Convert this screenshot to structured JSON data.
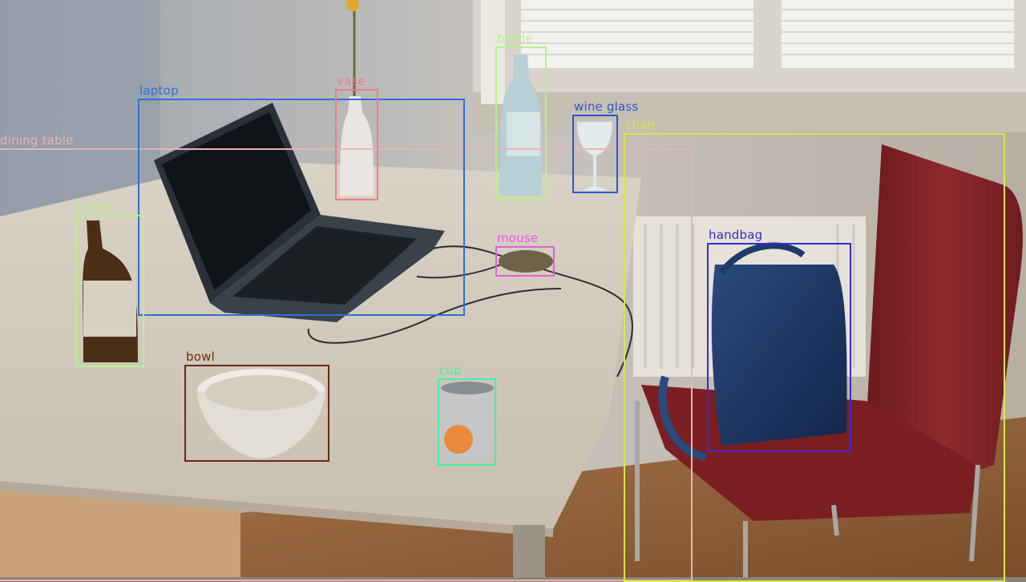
{
  "detections": [
    {
      "key": "dining_table",
      "label": "dining table",
      "color": "#e8b4b8"
    },
    {
      "key": "laptop",
      "label": "laptop",
      "color": "#2f6fd6"
    },
    {
      "key": "vase",
      "label": "vase",
      "color": "#f07a8a"
    },
    {
      "key": "bottle_1",
      "label": "bottle",
      "color": "#b8f08a"
    },
    {
      "key": "wine_glass",
      "label": "wine glass",
      "color": "#2a58c8"
    },
    {
      "key": "chair",
      "label": "chair",
      "color": "#d6e84a"
    },
    {
      "key": "mouse",
      "label": "mouse",
      "color": "#e060d8"
    },
    {
      "key": "handbag",
      "label": "handbag",
      "color": "#3a2ad0"
    },
    {
      "key": "bottle_2",
      "label": "bottle",
      "color": "#b8f08a"
    },
    {
      "key": "bowl",
      "label": "bowl",
      "color": "#6a2a12"
    },
    {
      "key": "cup",
      "label": "cup",
      "color": "#3ef0b0"
    }
  ]
}
